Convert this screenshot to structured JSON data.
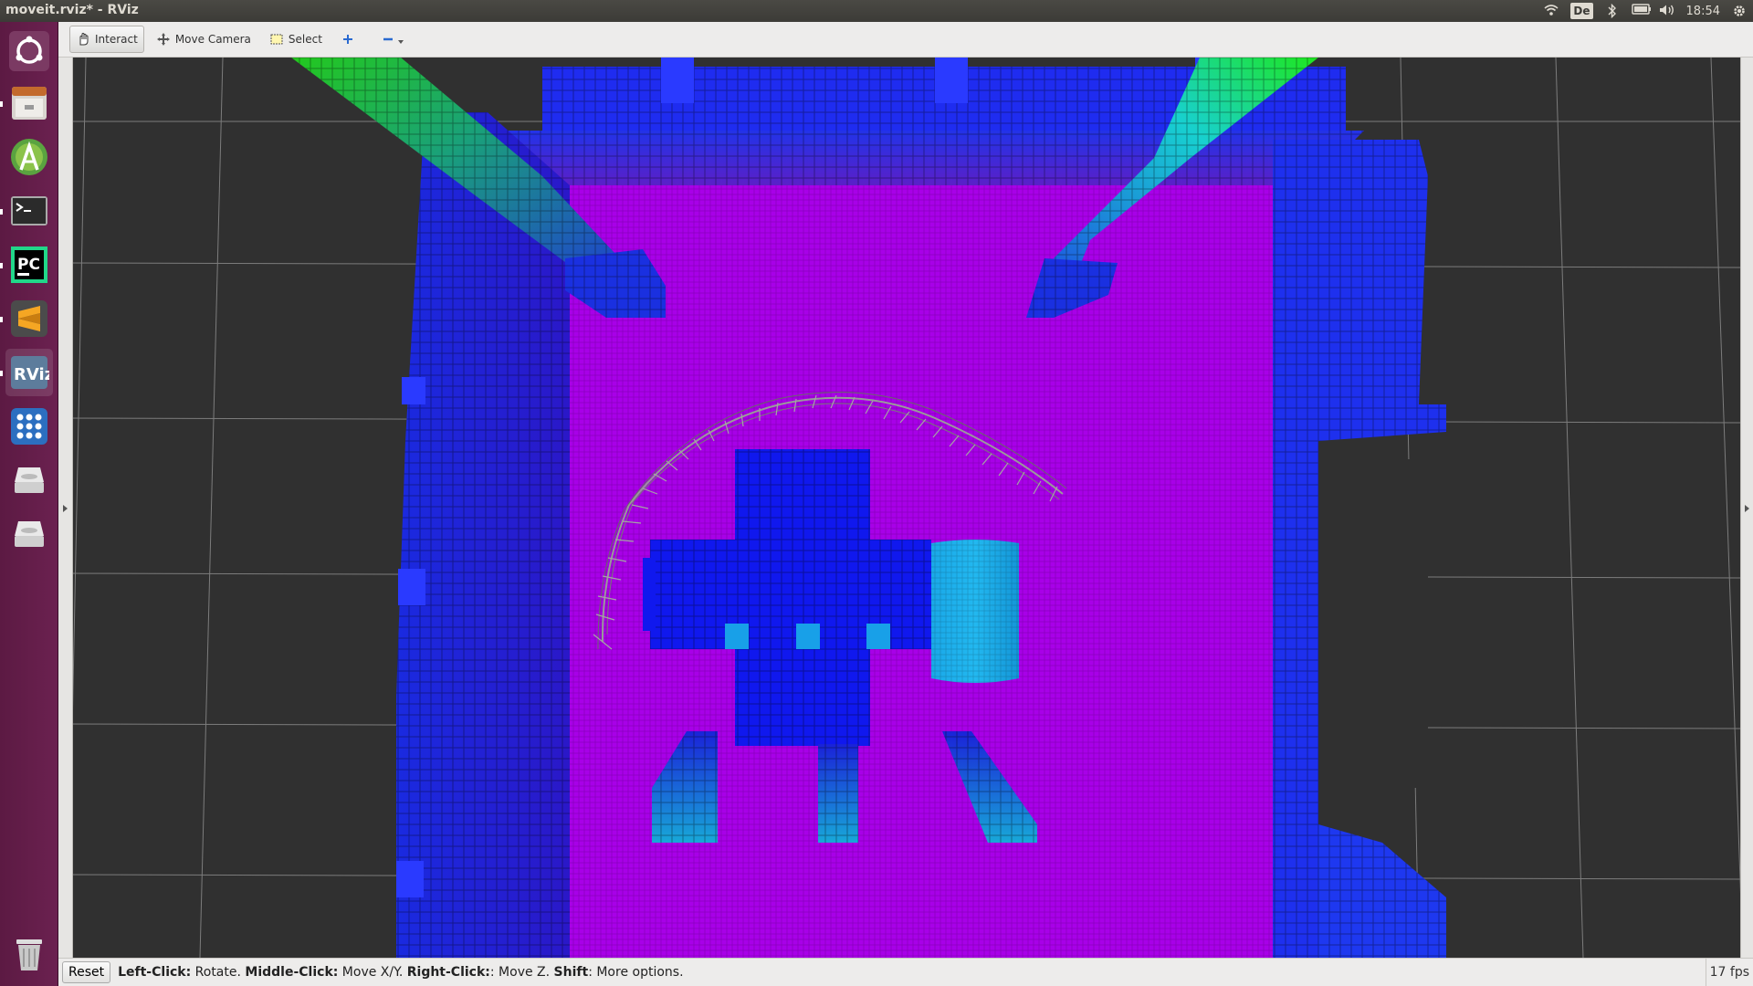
{
  "window": {
    "title": "moveit.rviz* - RViz"
  },
  "tray": {
    "keyboard": "De",
    "time": "18:54",
    "icons": [
      "wifi-icon",
      "keyboard-layout-icon",
      "bluetooth-icon",
      "battery-icon",
      "volume-icon",
      "settings-gear-icon"
    ]
  },
  "launcher": {
    "items": [
      {
        "name": "ubuntu-dash-icon",
        "color": "#b8b1ad"
      },
      {
        "name": "files-icon",
        "color": "#c8894a"
      },
      {
        "name": "android-studio-icon",
        "color": "#6ab344"
      },
      {
        "name": "terminal-icon",
        "color": "#2c2c2c"
      },
      {
        "name": "pycharm-icon",
        "color": "#21d789"
      },
      {
        "name": "sublime-text-icon",
        "color": "#f2a33c"
      },
      {
        "name": "rviz-icon",
        "color": "#6d8fb0"
      },
      {
        "name": "app-grid-icon",
        "color": "#2c6fc0"
      },
      {
        "name": "drive-icon",
        "color": "#d8d8d8"
      },
      {
        "name": "drive-icon",
        "color": "#d8d8d8"
      },
      {
        "name": "trash-icon",
        "color": "#cfcfcf"
      }
    ]
  },
  "toolbar": {
    "interact": "Interact",
    "move_camera": "Move Camera",
    "select": "Select"
  },
  "status": {
    "reset": "Reset",
    "h1": "Left-Click:",
    "t1": " Rotate. ",
    "h2": "Middle-Click:",
    "t2": " Move X/Y. ",
    "h3": "Right-Click:",
    "t3": ": Move Z. ",
    "h4": "Shift",
    "t4": ": More options.",
    "fps": "17 fps"
  },
  "colors": {
    "floor": "#a900e6",
    "wall": "#1a1aff",
    "accent_cyan": "#19b4ff",
    "accent_green": "#19e619",
    "grid_bg": "#303030"
  }
}
